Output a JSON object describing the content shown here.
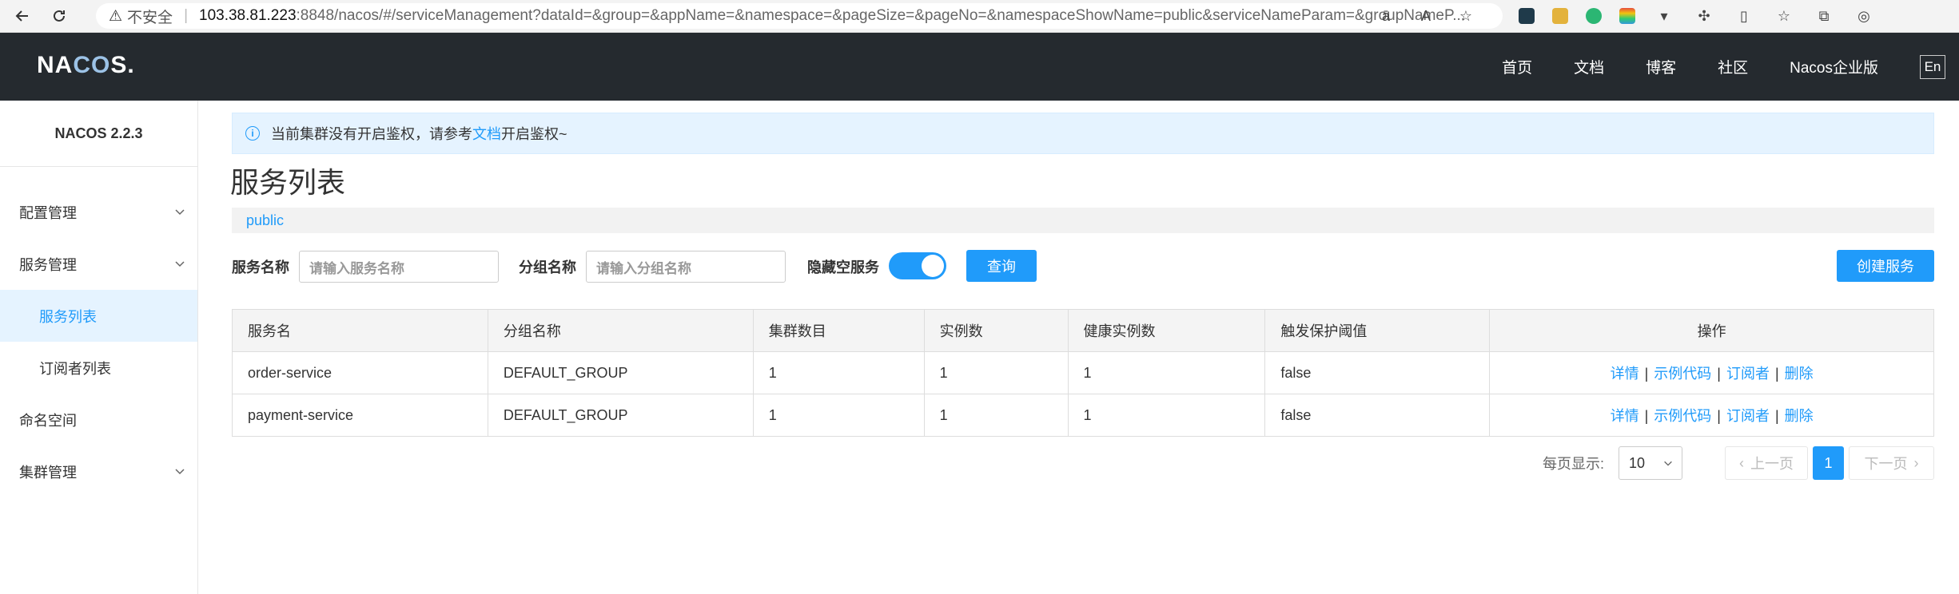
{
  "browser": {
    "insecure_label": "不安全",
    "url_host": "103.38.81.223",
    "url_path": ":8848/nacos/#/serviceManagement?dataId=&group=&appName=&namespace=&pageSize=&pageNo=&namespaceShowName=public&serviceNameParam=&groupNameP...",
    "icons": [
      "back-icon",
      "reload-icon",
      "warning-icon",
      "read-aloud-icon",
      "font-icon",
      "favorite-star-icon",
      "split-screen-icon",
      "favorites-icon",
      "collections-icon",
      "copilot-icon"
    ]
  },
  "header": {
    "logo_prefix": "NA",
    "logo_mid": "CO",
    "logo_suffix": "S.",
    "nav": [
      "首页",
      "文档",
      "博客",
      "社区",
      "Nacos企业版"
    ],
    "lang": "En"
  },
  "sidebar": {
    "title": "NACOS 2.2.3",
    "items": [
      {
        "label": "配置管理",
        "expandable": true
      },
      {
        "label": "服务管理",
        "expandable": true
      },
      {
        "label": "服务列表",
        "active": true
      },
      {
        "label": "订阅者列表"
      },
      {
        "label": "命名空间"
      },
      {
        "label": "集群管理",
        "expandable": true
      }
    ]
  },
  "notice": {
    "before": "当前集群没有开启鉴权，请参考",
    "link": "文档",
    "after": "开启鉴权~"
  },
  "page": {
    "title": "服务列表",
    "namespace": "public"
  },
  "filters": {
    "service_name_label": "服务名称",
    "service_name_placeholder": "请输入服务名称",
    "group_name_label": "分组名称",
    "group_name_placeholder": "请输入分组名称",
    "hide_empty_label": "隐藏空服务",
    "hide_empty_on": true,
    "query_button": "查询",
    "create_button": "创建服务"
  },
  "table": {
    "headers": [
      "服务名",
      "分组名称",
      "集群数目",
      "实例数",
      "健康实例数",
      "触发保护阈值",
      "操作"
    ],
    "rows": [
      [
        "order-service",
        "DEFAULT_GROUP",
        "1",
        "1",
        "1",
        "false"
      ],
      [
        "payment-service",
        "DEFAULT_GROUP",
        "1",
        "1",
        "1",
        "false"
      ]
    ],
    "ops": [
      "详情",
      "示例代码",
      "订阅者",
      "删除"
    ]
  },
  "pagination": {
    "per_page_label": "每页显示:",
    "page_size": "10",
    "prev": "上一页",
    "current": "1",
    "next": "下一页"
  },
  "colors": {
    "primary": "#209bfa",
    "header_bg": "#252a2f",
    "active_bg": "#e5f3ff"
  }
}
